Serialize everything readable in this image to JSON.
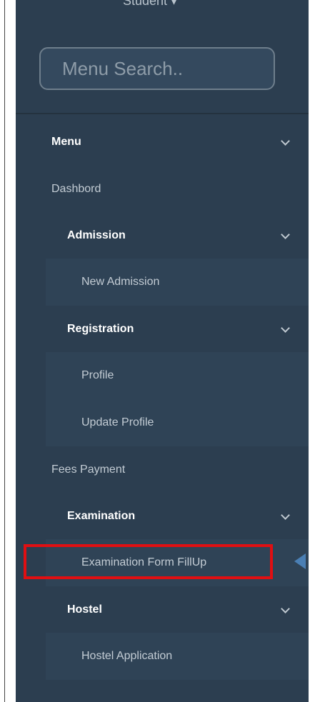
{
  "user": {
    "label": "Student ▾"
  },
  "search": {
    "placeholder": "Menu Search.."
  },
  "menu": {
    "title": "Menu",
    "dashboard": "Dashbord",
    "admission": {
      "label": "Admission",
      "items": [
        "New Admission"
      ]
    },
    "registration": {
      "label": "Registration",
      "items": [
        "Profile",
        "Update Profile"
      ]
    },
    "fees": "Fees Payment",
    "examination": {
      "label": "Examination",
      "items": [
        "Examination Form FillUp"
      ]
    },
    "hostel": {
      "label": "Hostel",
      "items": [
        "Hostel Application"
      ]
    }
  },
  "colors": {
    "sidebar_bg": "#2c3e50",
    "highlight": "#e10f12",
    "pointer": "#4a7fb4"
  }
}
